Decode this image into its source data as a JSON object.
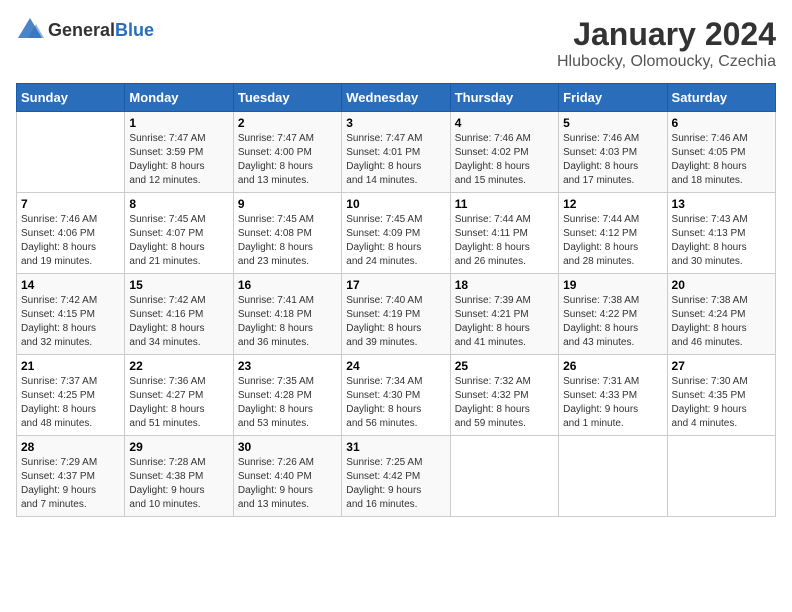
{
  "logo": {
    "general": "General",
    "blue": "Blue"
  },
  "header": {
    "title": "January 2024",
    "subtitle": "Hlubocky, Olomoucky, Czechia"
  },
  "weekdays": [
    "Sunday",
    "Monday",
    "Tuesday",
    "Wednesday",
    "Thursday",
    "Friday",
    "Saturday"
  ],
  "weeks": [
    [
      {
        "day": "",
        "info": ""
      },
      {
        "day": "1",
        "info": "Sunrise: 7:47 AM\nSunset: 3:59 PM\nDaylight: 8 hours\nand 12 minutes."
      },
      {
        "day": "2",
        "info": "Sunrise: 7:47 AM\nSunset: 4:00 PM\nDaylight: 8 hours\nand 13 minutes."
      },
      {
        "day": "3",
        "info": "Sunrise: 7:47 AM\nSunset: 4:01 PM\nDaylight: 8 hours\nand 14 minutes."
      },
      {
        "day": "4",
        "info": "Sunrise: 7:46 AM\nSunset: 4:02 PM\nDaylight: 8 hours\nand 15 minutes."
      },
      {
        "day": "5",
        "info": "Sunrise: 7:46 AM\nSunset: 4:03 PM\nDaylight: 8 hours\nand 17 minutes."
      },
      {
        "day": "6",
        "info": "Sunrise: 7:46 AM\nSunset: 4:05 PM\nDaylight: 8 hours\nand 18 minutes."
      }
    ],
    [
      {
        "day": "7",
        "info": "Sunrise: 7:46 AM\nSunset: 4:06 PM\nDaylight: 8 hours\nand 19 minutes."
      },
      {
        "day": "8",
        "info": "Sunrise: 7:45 AM\nSunset: 4:07 PM\nDaylight: 8 hours\nand 21 minutes."
      },
      {
        "day": "9",
        "info": "Sunrise: 7:45 AM\nSunset: 4:08 PM\nDaylight: 8 hours\nand 23 minutes."
      },
      {
        "day": "10",
        "info": "Sunrise: 7:45 AM\nSunset: 4:09 PM\nDaylight: 8 hours\nand 24 minutes."
      },
      {
        "day": "11",
        "info": "Sunrise: 7:44 AM\nSunset: 4:11 PM\nDaylight: 8 hours\nand 26 minutes."
      },
      {
        "day": "12",
        "info": "Sunrise: 7:44 AM\nSunset: 4:12 PM\nDaylight: 8 hours\nand 28 minutes."
      },
      {
        "day": "13",
        "info": "Sunrise: 7:43 AM\nSunset: 4:13 PM\nDaylight: 8 hours\nand 30 minutes."
      }
    ],
    [
      {
        "day": "14",
        "info": "Sunrise: 7:42 AM\nSunset: 4:15 PM\nDaylight: 8 hours\nand 32 minutes."
      },
      {
        "day": "15",
        "info": "Sunrise: 7:42 AM\nSunset: 4:16 PM\nDaylight: 8 hours\nand 34 minutes."
      },
      {
        "day": "16",
        "info": "Sunrise: 7:41 AM\nSunset: 4:18 PM\nDaylight: 8 hours\nand 36 minutes."
      },
      {
        "day": "17",
        "info": "Sunrise: 7:40 AM\nSunset: 4:19 PM\nDaylight: 8 hours\nand 39 minutes."
      },
      {
        "day": "18",
        "info": "Sunrise: 7:39 AM\nSunset: 4:21 PM\nDaylight: 8 hours\nand 41 minutes."
      },
      {
        "day": "19",
        "info": "Sunrise: 7:38 AM\nSunset: 4:22 PM\nDaylight: 8 hours\nand 43 minutes."
      },
      {
        "day": "20",
        "info": "Sunrise: 7:38 AM\nSunset: 4:24 PM\nDaylight: 8 hours\nand 46 minutes."
      }
    ],
    [
      {
        "day": "21",
        "info": "Sunrise: 7:37 AM\nSunset: 4:25 PM\nDaylight: 8 hours\nand 48 minutes."
      },
      {
        "day": "22",
        "info": "Sunrise: 7:36 AM\nSunset: 4:27 PM\nDaylight: 8 hours\nand 51 minutes."
      },
      {
        "day": "23",
        "info": "Sunrise: 7:35 AM\nSunset: 4:28 PM\nDaylight: 8 hours\nand 53 minutes."
      },
      {
        "day": "24",
        "info": "Sunrise: 7:34 AM\nSunset: 4:30 PM\nDaylight: 8 hours\nand 56 minutes."
      },
      {
        "day": "25",
        "info": "Sunrise: 7:32 AM\nSunset: 4:32 PM\nDaylight: 8 hours\nand 59 minutes."
      },
      {
        "day": "26",
        "info": "Sunrise: 7:31 AM\nSunset: 4:33 PM\nDaylight: 9 hours\nand 1 minute."
      },
      {
        "day": "27",
        "info": "Sunrise: 7:30 AM\nSunset: 4:35 PM\nDaylight: 9 hours\nand 4 minutes."
      }
    ],
    [
      {
        "day": "28",
        "info": "Sunrise: 7:29 AM\nSunset: 4:37 PM\nDaylight: 9 hours\nand 7 minutes."
      },
      {
        "day": "29",
        "info": "Sunrise: 7:28 AM\nSunset: 4:38 PM\nDaylight: 9 hours\nand 10 minutes."
      },
      {
        "day": "30",
        "info": "Sunrise: 7:26 AM\nSunset: 4:40 PM\nDaylight: 9 hours\nand 13 minutes."
      },
      {
        "day": "31",
        "info": "Sunrise: 7:25 AM\nSunset: 4:42 PM\nDaylight: 9 hours\nand 16 minutes."
      },
      {
        "day": "",
        "info": ""
      },
      {
        "day": "",
        "info": ""
      },
      {
        "day": "",
        "info": ""
      }
    ]
  ]
}
